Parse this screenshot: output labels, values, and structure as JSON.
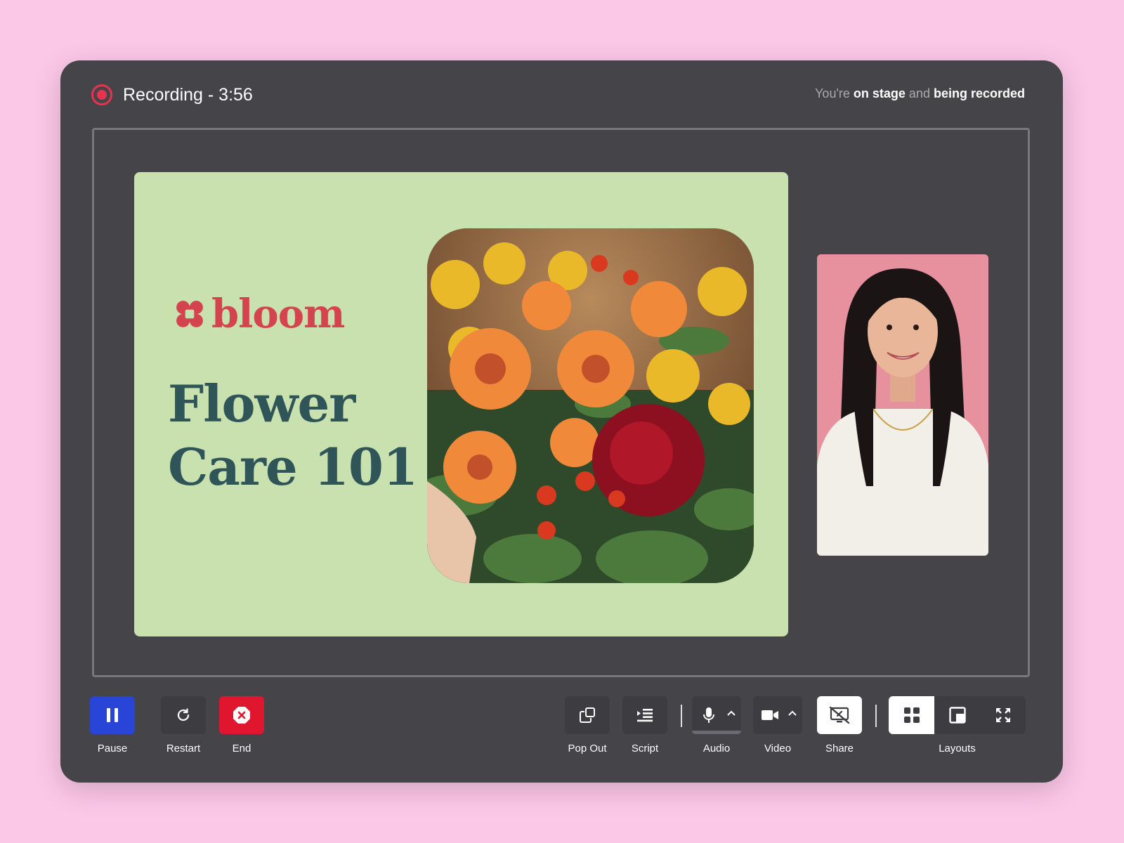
{
  "header": {
    "recording_label": "Recording - 3:56",
    "status": {
      "prefix": "You're ",
      "strong1": "on stage",
      "middle": " and ",
      "strong2": "being recorded"
    }
  },
  "slide": {
    "brand": "bloom",
    "title_line1": "Flower",
    "title_line2": "Care 101"
  },
  "controls": {
    "pause": "Pause",
    "restart": "Restart",
    "end": "End",
    "pop_out": "Pop Out",
    "script": "Script",
    "audio": "Audio",
    "video": "Video",
    "share": "Share",
    "layouts": "Layouts"
  },
  "icons": {
    "record": "record-icon",
    "pause": "pause-icon",
    "restart": "restart-icon",
    "end": "stop-icon",
    "pop_out": "pop-out-icon",
    "script": "script-icon",
    "audio": "microphone-icon",
    "video": "camera-icon",
    "share": "screen-share-off-icon",
    "layout_grid": "grid-layout-icon",
    "layout_pip": "picture-in-picture-icon",
    "layout_fullscreen": "fullscreen-icon"
  },
  "colors": {
    "background": "#fcc8e8",
    "window": "#444449",
    "recording_red": "#e8334f",
    "pause_blue": "#2845d8",
    "end_red": "#e0162f",
    "slide_green": "#c8e1ae",
    "brand_red": "#d4444e",
    "title_teal": "#2f5559",
    "presenter_bg": "#e8919e"
  }
}
